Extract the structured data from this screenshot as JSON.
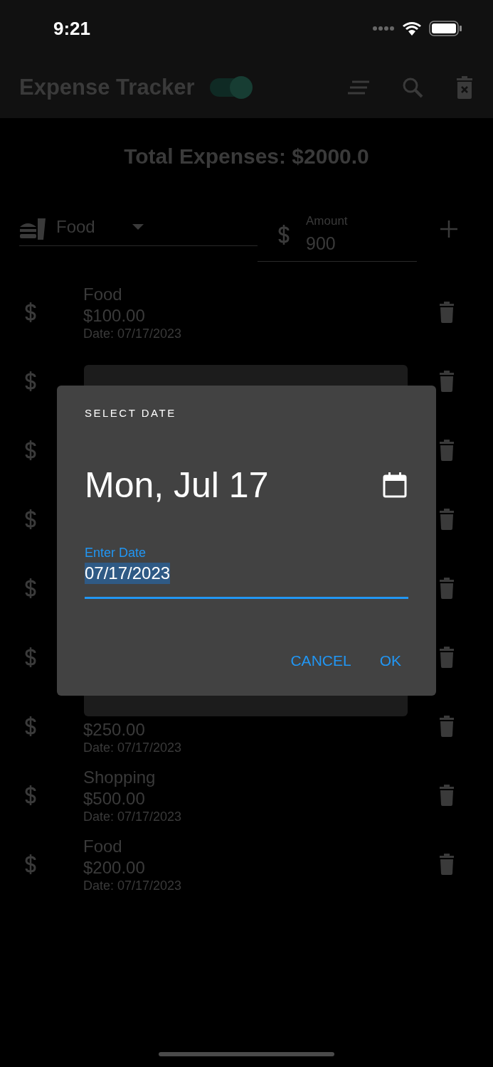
{
  "status_bar": {
    "time": "9:21"
  },
  "app_bar": {
    "title": "Expense Tracker",
    "dark_mode_toggle": {
      "on": true
    }
  },
  "total": "Total Expenses: $2000.0",
  "form": {
    "category": {
      "value": "Food"
    },
    "amount": {
      "label": "Amount",
      "value": "900"
    }
  },
  "expenses": [
    {
      "kind": "entry",
      "category": "Food",
      "amount": "$100.00",
      "date": "Date: 07/17/2023"
    },
    {
      "kind": "covered"
    },
    {
      "kind": "covered"
    },
    {
      "kind": "covered"
    },
    {
      "kind": "covered"
    },
    {
      "kind": "covered"
    },
    {
      "kind": "partial",
      "amount": "$250.00",
      "date": "Date: 07/17/2023"
    },
    {
      "kind": "entry",
      "category": "Shopping",
      "amount": "$500.00",
      "date": "Date: 07/17/2023"
    },
    {
      "kind": "entry",
      "category": "Food",
      "amount": "$200.00",
      "date": "Date: 07/17/2023"
    }
  ],
  "dialog": {
    "title": "SELECT DATE",
    "headline": "Mon, Jul 17",
    "field": {
      "label": "Enter Date",
      "value": "07/17/2023",
      "text_selected": true
    },
    "buttons": [
      "CANCEL",
      "OK"
    ]
  }
}
